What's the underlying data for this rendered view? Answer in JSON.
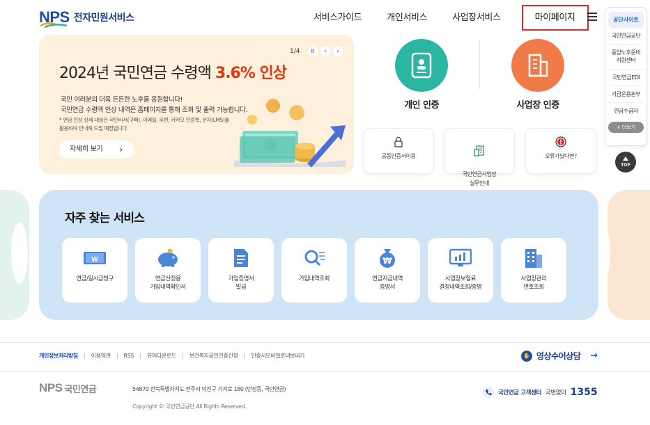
{
  "header": {
    "logo_mark": "NPS",
    "logo_text": "전자민원서비스",
    "nav": [
      "서비스가이드",
      "개인서비스",
      "사업장서비스",
      "마이페이지"
    ]
  },
  "quick_menu": {
    "title": "공단사이트",
    "items": [
      "국민연금공단",
      "중앙노후준비\n지원센터",
      "국민연금EDI",
      "기금운용본부",
      "연금수급자"
    ],
    "more": "+ 더보기",
    "top": "TOP"
  },
  "banner": {
    "pager": "1/4",
    "title_prefix": "2024년 국민연금 수령액 ",
    "title_highlight": "3.6% 인상",
    "desc": "국민 여러분의 더욱 든든한 노후를 응원합니다!\n국민연금 수령액 인상 내역은 홈페이지를 통해 조회 및 출력 가능합니다.",
    "note": "* 연금 인상 상세 내용은 국민비서(구삐), 이메일, 우편, 카카오 인증톡, 문자(LMS)를\n   활용하여 안내해 드릴 예정입니다.",
    "button": "자세히 보기",
    "ctrl_pause": "II",
    "ctrl_prev": "‹",
    "ctrl_next": "›"
  },
  "auth": {
    "personal": "개인 인증",
    "business": "사업장 인증"
  },
  "tiles": [
    "공동인증서이용",
    "국민연금사업장\n실무안내",
    "오류가났다면?"
  ],
  "services": {
    "title": "자주 찾는 서비스",
    "items": [
      {
        "label": "연금/일시금청구",
        "icon": "pension-claim-icon"
      },
      {
        "label": "연금산정용\n가입내역확인서",
        "icon": "piggy-bank-icon"
      },
      {
        "label": "가입증명서\n발급",
        "icon": "document-icon"
      },
      {
        "label": "가입내역조회",
        "icon": "search-list-icon"
      },
      {
        "label": "연금지급내역\n증명서",
        "icon": "money-bag-icon"
      },
      {
        "label": "사업장보험료\n결정내역조회/증명",
        "icon": "monitor-chart-icon"
      },
      {
        "label": "사업장관리\n번호조회",
        "icon": "building-icon"
      }
    ]
  },
  "footer": {
    "links": [
      "개인정보처리방침",
      "이용약관",
      "RSS",
      "뷰어다운로드",
      "보건복지공인인증신청",
      "인증서모바일로내보내기"
    ],
    "video_counsel": "영상수어상담",
    "logo_mark": "NPS",
    "logo_text": "국민연금",
    "address": "54870 전북특별자치도 전주시 덕진구 기지로 180 (만성동, 국민연금)",
    "copyright": "Copyright © 국민연금공단 All Rights Reserved.",
    "callcenter_label": "국민연금 고객센터",
    "callcenter_sub": "국번없이",
    "callcenter_number": "1355"
  },
  "colors": {
    "accent_blue": "#1e4fa3",
    "highlight_red": "#e0370e",
    "personal_green": "#2bb5a3",
    "business_orange": "#f07a48",
    "band_blue": "#cfe4f7"
  }
}
